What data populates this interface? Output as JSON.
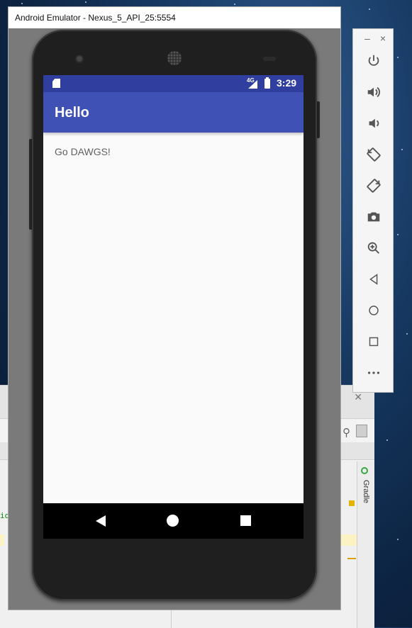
{
  "emulator": {
    "window_title": "Android Emulator - Nexus_5_API_25:5554",
    "status_bar": {
      "network_label": "4G",
      "time": "3:29"
    },
    "app": {
      "title": "Hello",
      "content_text": "Go DAWGS!"
    },
    "toolbar": {
      "minimize_label": "–",
      "close_label": "×",
      "buttons": [
        {
          "icon": "power-icon"
        },
        {
          "icon": "volume-up-icon"
        },
        {
          "icon": "volume-down-icon"
        },
        {
          "icon": "rotate-left-icon"
        },
        {
          "icon": "rotate-right-icon"
        },
        {
          "icon": "camera-icon"
        },
        {
          "icon": "zoom-icon"
        },
        {
          "icon": "back-icon"
        },
        {
          "icon": "home-icon"
        },
        {
          "icon": "overview-icon"
        },
        {
          "icon": "more-icon"
        }
      ]
    }
  },
  "studio": {
    "gradle_tab_label": "Gradle",
    "editor_snippet": "id"
  },
  "colors": {
    "status_bar": "#303f9f",
    "app_bar": "#3f51b5",
    "screen_bg": "#fafafa",
    "nav_bar": "#000000"
  }
}
